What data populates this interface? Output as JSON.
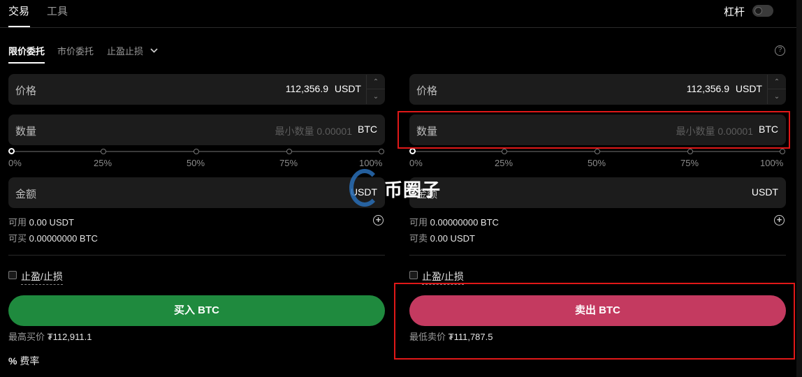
{
  "top_tabs": [
    {
      "label": "交易",
      "active": true
    },
    {
      "label": "工具",
      "active": false
    }
  ],
  "leverage": {
    "label": "杠杆",
    "enabled": false
  },
  "order_types": [
    {
      "label": "限价委托",
      "active": true
    },
    {
      "label": "市价委托",
      "active": false
    },
    {
      "label": "止盈止损",
      "active": false,
      "dropdown": true
    }
  ],
  "buy": {
    "price": {
      "label": "价格",
      "value": "112,356.9",
      "unit": "USDT"
    },
    "quantity": {
      "label": "数量",
      "placeholder": "最小数量 0.00001",
      "unit": "BTC"
    },
    "slider": {
      "ticks": [
        "0%",
        "25%",
        "50%",
        "75%",
        "100%"
      ],
      "value_percent": 0
    },
    "amount": {
      "label": "金额",
      "unit": "USDT"
    },
    "available": {
      "label": "可用",
      "value": "0.00 USDT"
    },
    "can_trade": {
      "label": "可买",
      "value": "0.00000000 BTC"
    },
    "tpsl_label": "止盈/止损",
    "button_label": "买入 BTC",
    "best_price": {
      "label": "最高买价",
      "value": "₮112,911.1"
    }
  },
  "sell": {
    "price": {
      "label": "价格",
      "value": "112,356.9",
      "unit": "USDT"
    },
    "quantity": {
      "label": "数量",
      "placeholder": "最小数量 0.00001",
      "unit": "BTC"
    },
    "slider": {
      "ticks": [
        "0%",
        "25%",
        "50%",
        "75%",
        "100%"
      ],
      "value_percent": 0
    },
    "amount": {
      "label": "金额",
      "unit": "USDT"
    },
    "available": {
      "label": "可用",
      "value": "0.00000000 BTC"
    },
    "can_trade": {
      "label": "可卖",
      "value": "0.00 USDT"
    },
    "tpsl_label": "止盈/止损",
    "button_label": "卖出 BTC",
    "best_price": {
      "label": "最低卖价",
      "value": "₮111,787.5"
    }
  },
  "fee_label": "费率",
  "watermark": "币圈子",
  "colors": {
    "buy": "#1f8a3e",
    "sell": "#c43a60",
    "highlight": "#e01818",
    "background": "#000000"
  }
}
